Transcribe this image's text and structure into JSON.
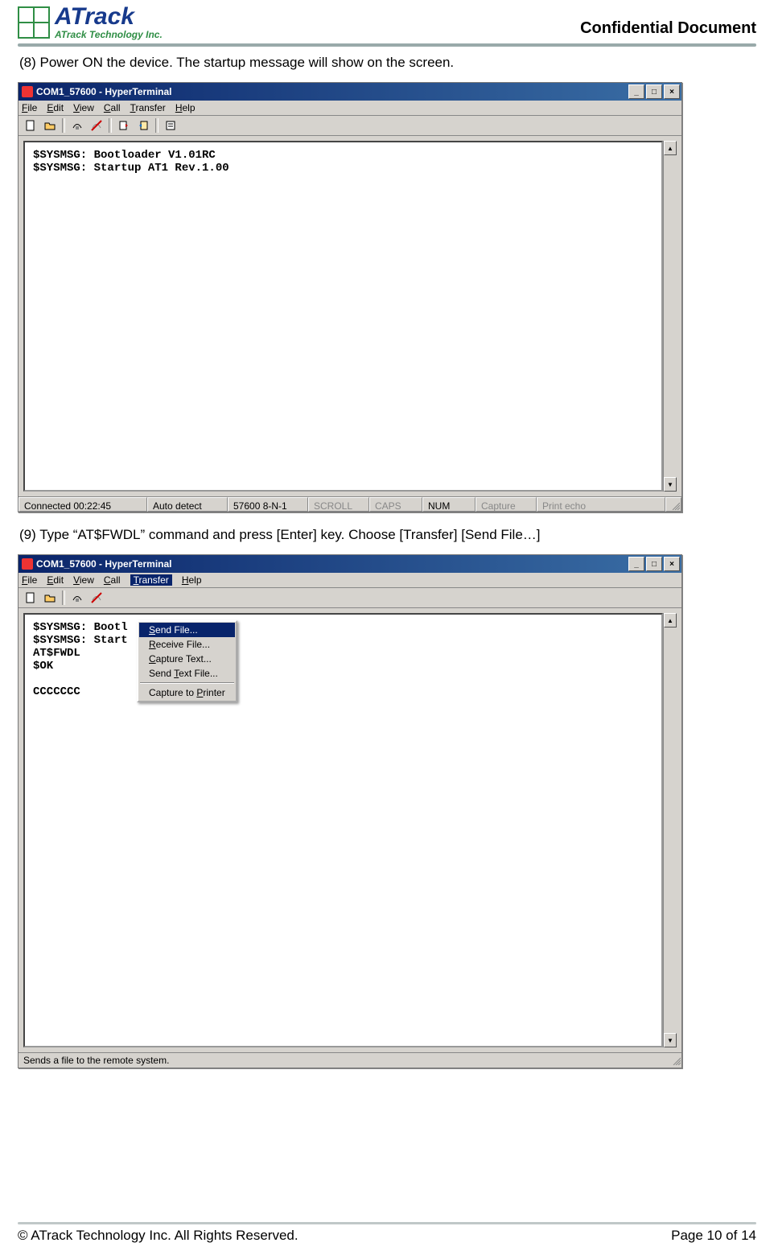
{
  "header": {
    "logo_text": "ATrack",
    "logo_sub": "ATrack Technology Inc.",
    "confidential": "Confidential  Document"
  },
  "step8_text": "(8) Power ON the device. The startup message will show on the screen.",
  "step9_text": "(9) Type “AT$FWDL” command and press [Enter] key. Choose [Transfer]    [Send File…]",
  "win1": {
    "title": "COM1_57600 - HyperTerminal",
    "menus": {
      "file": "File",
      "edit": "Edit",
      "view": "View",
      "call": "Call",
      "transfer": "Transfer",
      "help": "Help"
    },
    "terminal_lines": "$SYSMSG: Bootloader V1.01RC\n$SYSMSG: Startup AT1 Rev.1.00",
    "status": {
      "connected": "Connected 00:22:45",
      "detect": "Auto detect",
      "params": "57600 8-N-1",
      "scroll": "SCROLL",
      "caps": "CAPS",
      "num": "NUM",
      "capture": "Capture",
      "printecho": "Print echo"
    }
  },
  "win2": {
    "title": "COM1_57600 - HyperTerminal",
    "menus": {
      "file": "File",
      "edit": "Edit",
      "view": "View",
      "call": "Call",
      "transfer": "Transfer",
      "help": "Help"
    },
    "dropdown": {
      "send_file": "Send File...",
      "receive_file": "Receive File...",
      "capture_text": "Capture Text...",
      "send_text_file": "Send Text File...",
      "capture_to_printer": "Capture to Printer"
    },
    "terminal_lines": "$SYSMSG: Bootl\n$SYSMSG: Start\nAT$FWDL\n$OK\n\nCCCCCCC",
    "status_msg": "Sends a file to the remote system."
  },
  "footer": {
    "copyright": "© ATrack Technology Inc. All Rights Reserved.",
    "page": "Page 10 of 14"
  }
}
